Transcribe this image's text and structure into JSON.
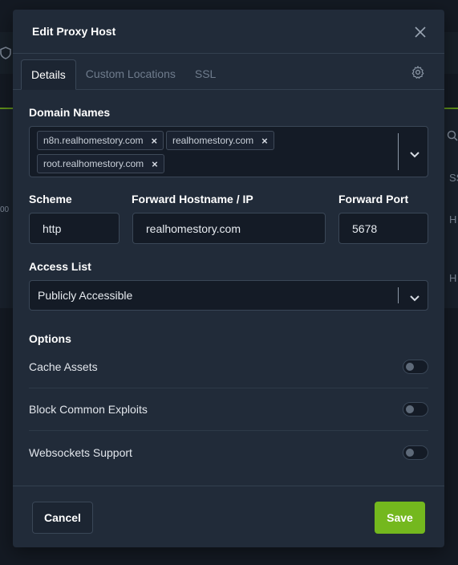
{
  "modal": {
    "title": "Edit Proxy Host",
    "tabs": [
      {
        "label": "Details"
      },
      {
        "label": "Custom Locations"
      },
      {
        "label": "SSL"
      }
    ]
  },
  "domain_names": {
    "label": "Domain Names",
    "chips": [
      "n8n.realhomestory.com",
      "realhomestory.com",
      "root.realhomestory.com"
    ],
    "remove_glyph": "×"
  },
  "scheme": {
    "label": "Scheme",
    "value": "http"
  },
  "forward_host": {
    "label": "Forward Hostname / IP",
    "value": "realhomestory.com"
  },
  "forward_port": {
    "label": "Forward Port",
    "value": "5678"
  },
  "access_list": {
    "label": "Access List",
    "value": "Publicly Accessible"
  },
  "options": {
    "label": "Options",
    "items": [
      {
        "label": "Cache Assets",
        "enabled": false
      },
      {
        "label": "Block Common Exploits",
        "enabled": false
      },
      {
        "label": "Websockets Support",
        "enabled": false
      }
    ]
  },
  "footer": {
    "cancel_label": "Cancel",
    "save_label": "Save"
  },
  "background": {
    "fragment_1": "SS",
    "fragment_2": "H",
    "fragment_3": "H",
    "fragment_4": "00"
  },
  "colors": {
    "accent": "#74b81e",
    "modal_bg": "#212b39",
    "input_bg": "#141b26"
  }
}
